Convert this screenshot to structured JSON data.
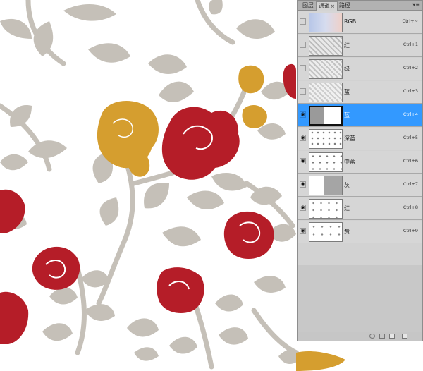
{
  "panel": {
    "tabs": [
      {
        "label": "图层"
      },
      {
        "label": "通道",
        "active": true
      },
      {
        "label": "路径"
      }
    ],
    "tab_close": "×",
    "menu_glyph": "▾≡",
    "channels": [
      {
        "label": "RGB",
        "shortcut": "Ctrl+~",
        "visible": false,
        "selected": false
      },
      {
        "label": "红",
        "shortcut": "Ctrl+1",
        "visible": false,
        "selected": false
      },
      {
        "label": "绿",
        "shortcut": "Ctrl+2",
        "visible": false,
        "selected": false
      },
      {
        "label": "蓝",
        "shortcut": "Ctrl+3",
        "visible": false,
        "selected": false
      },
      {
        "label": "蓝",
        "shortcut": "Ctrl+4",
        "visible": true,
        "selected": true
      },
      {
        "label": "深蓝",
        "shortcut": "Ctrl+5",
        "visible": true,
        "selected": false
      },
      {
        "label": "中蓝",
        "shortcut": "Ctrl+6",
        "visible": true,
        "selected": false
      },
      {
        "label": "灰",
        "shortcut": "Ctrl+7",
        "visible": true,
        "selected": false
      },
      {
        "label": "红",
        "shortcut": "Ctrl+8",
        "visible": true,
        "selected": false
      },
      {
        "label": "黄",
        "shortcut": "Ctrl+9",
        "visible": true,
        "selected": false
      }
    ],
    "eye_glyph": "◉"
  },
  "colors": {
    "leaf": "#c5c0b8",
    "rose_red": "#b51d28",
    "rose_gold": "#d59e2f",
    "selection": "#3399ff"
  }
}
